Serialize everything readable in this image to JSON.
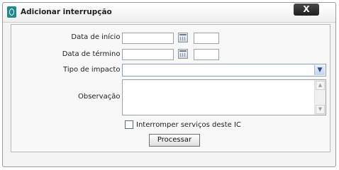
{
  "dialog": {
    "title": "Adicionar interrupção",
    "close_label": "X",
    "icon": "app-logo-icon"
  },
  "form": {
    "start_date": {
      "label": "Data de início :",
      "date_value": "",
      "time_value": ""
    },
    "end_date": {
      "label": "Data de término :",
      "date_value": "",
      "time_value": ""
    },
    "impact_type": {
      "label": "Tipo de impacto :",
      "selected": ""
    },
    "observation": {
      "label": "Observação :",
      "value": ""
    },
    "interrupt_services": {
      "label": "Interromper serviços deste IC",
      "checked": false
    },
    "submit_label": "Processar"
  },
  "colors": {
    "accent": "#1f8a8a",
    "close_button": "#2a2a2a",
    "select_border": "#8aa0c0"
  }
}
